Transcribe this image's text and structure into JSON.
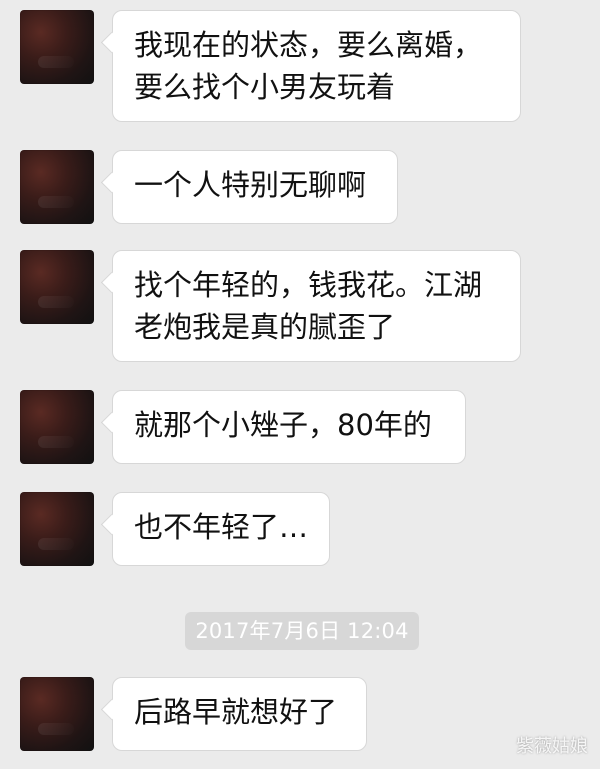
{
  "messages": [
    {
      "text": "我现在的状态，要么离婚，\n要么找个小男友玩着"
    },
    {
      "text": "一个人特别无聊啊"
    },
    {
      "text": "找个年轻的，钱我花。江湖\n老炮我是真的腻歪了"
    },
    {
      "text": "就那个小矬子，80年的"
    },
    {
      "text": "也不年轻了…"
    },
    {
      "text": "后路早就想好了"
    }
  ],
  "timestamp": "2017年7月6日 12:04",
  "watermark": "紫薇姑娘"
}
